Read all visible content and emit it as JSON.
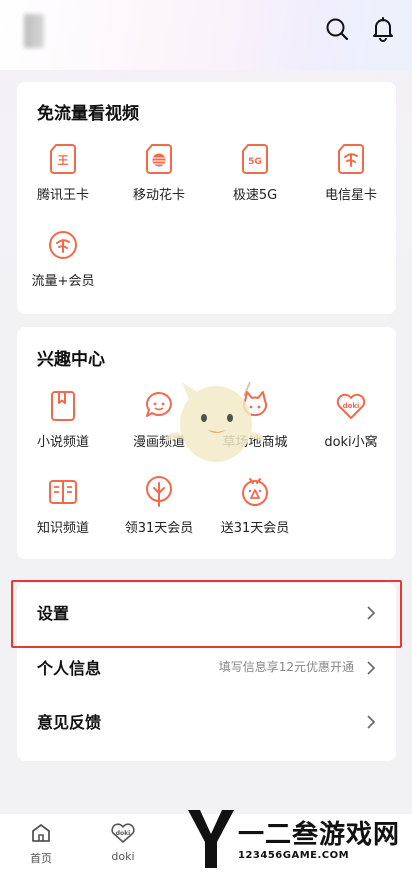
{
  "colors": {
    "accent": "#f26a4b",
    "highlight_border": "#e53935",
    "background": "#f2f2f4"
  },
  "free_data": {
    "title": "免流量看视频",
    "items": [
      {
        "label": "腾讯王卡",
        "icon": "wang-card-icon",
        "glyph": "王"
      },
      {
        "label": "移动花卡",
        "icon": "mobile-flower-card-icon",
        "glyph": ""
      },
      {
        "label": "极速5G",
        "icon": "5g-icon",
        "glyph": "5G"
      },
      {
        "label": "电信星卡",
        "icon": "telecom-star-card-icon",
        "glyph": ""
      },
      {
        "label": "流量+会员",
        "icon": "data-plus-vip-icon",
        "glyph": ""
      }
    ]
  },
  "interest": {
    "title": "兴趣中心",
    "items": [
      {
        "label": "小说频道",
        "icon": "novel-channel-icon"
      },
      {
        "label": "漫画频道",
        "icon": "comic-channel-icon"
      },
      {
        "label": "草场地商城",
        "icon": "mall-icon"
      },
      {
        "label": "doki小窝",
        "icon": "doki-nest-icon",
        "glyph": "doki"
      },
      {
        "label": "知识频道",
        "icon": "knowledge-channel-icon"
      },
      {
        "label": "领31天会员",
        "icon": "claim-vip-icon"
      },
      {
        "label": "送31天会员",
        "icon": "gift-vip-icon"
      }
    ]
  },
  "settings": {
    "settings_label": "设置",
    "personal_info_label": "个人信息",
    "personal_info_hint": "填写信息享12元优惠开通",
    "feedback_label": "意见反馈"
  },
  "bottom_nav": [
    {
      "label": "首页",
      "icon": "home-icon"
    },
    {
      "label": "doki",
      "icon": "doki-icon",
      "glyph": "doki"
    }
  ],
  "watermark": {
    "title": "一二叁游戏网",
    "sub": "123456GAME.COM"
  }
}
